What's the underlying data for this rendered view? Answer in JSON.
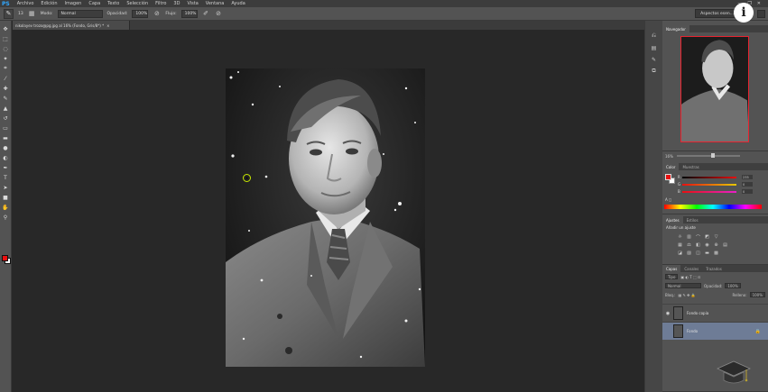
{
  "menu": {
    "app_logo": "PS",
    "items": [
      "Archivo",
      "Edición",
      "Imagen",
      "Capa",
      "Texto",
      "Selección",
      "Filtro",
      "3D",
      "Vista",
      "Ventana",
      "Ayuda"
    ],
    "window_controls": [
      "—",
      "❐",
      "✕"
    ]
  },
  "options": {
    "brush_size": "13",
    "mode_label": "Modo:",
    "mode_value": "Normal",
    "opacity_label": "Opacidad:",
    "opacity_value": "100%",
    "flow_label": "Flujo:",
    "flow_value": "100%",
    "workspace": "Aspectos esen..."
  },
  "document": {
    "tab_title": "nikolayev trozo@pg.jpg al 16% (Fondo, Gris/8*) *",
    "close": "×"
  },
  "navigator": {
    "tab": "Navegador",
    "zoom": "16%"
  },
  "color_panel": {
    "tabs": [
      "Color",
      "Muestras"
    ],
    "channels": [
      {
        "label": "R",
        "value": "235",
        "color": "#e81010"
      },
      {
        "label": "G",
        "value": "0",
        "color": "#e8c800"
      },
      {
        "label": "B",
        "value": "0",
        "color": "#e820c8"
      }
    ]
  },
  "adjustments": {
    "tabs": [
      "Ajustes",
      "Estilos"
    ],
    "title": "Añadir un ajuste"
  },
  "layers": {
    "tabs": [
      "Capas",
      "Canales",
      "Trazados"
    ],
    "kind_label": "Tipo",
    "blend": "Normal",
    "opacity_label": "Opacidad:",
    "opacity": "100%",
    "lock_label": "Bloq.:",
    "fill_label": "Relleno:",
    "fill": "100%",
    "items": [
      {
        "name": "Fondo copia",
        "visible": true,
        "active": false
      },
      {
        "name": "Fondo",
        "visible": false,
        "active": true
      }
    ]
  },
  "colors": {
    "foreground": "#e81010",
    "background": "#ffffff",
    "selection_highlight": "#6e7c96",
    "navigator_frame": "#e8232f"
  }
}
